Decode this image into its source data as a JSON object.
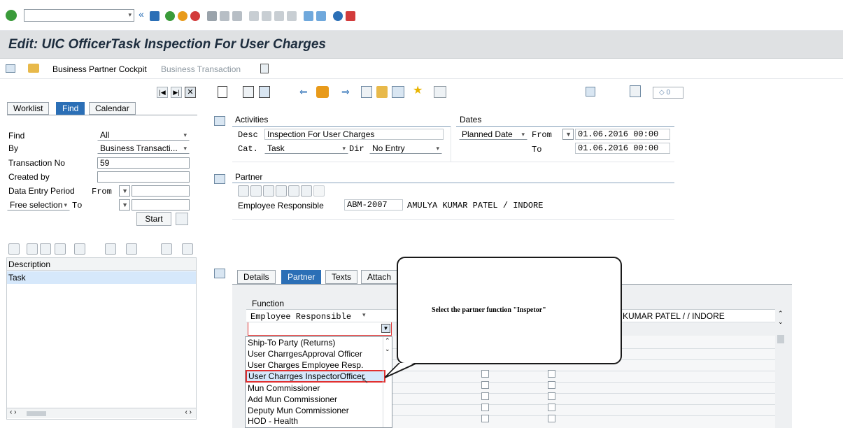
{
  "header": {
    "title": "Edit: UIC OfficerTask Inspection For User Charges",
    "toolbar_links": {
      "business_partner_cockpit": "Business Partner Cockpit",
      "business_transaction": "Business Transaction"
    },
    "counter_value": "◇ 0"
  },
  "left_panel": {
    "tabs": [
      {
        "label": "Worklist",
        "active": false
      },
      {
        "label": "Find",
        "active": true
      },
      {
        "label": "Calendar",
        "active": false
      }
    ],
    "find": {
      "find_label": "Find",
      "find_value": "All",
      "by_label": "By",
      "by_value": "Business Transacti...",
      "transaction_no_label": "Transaction No",
      "transaction_no_value": "59",
      "created_by_label": "Created by",
      "created_by_value": "",
      "data_entry_label": "Data Entry Period",
      "from_label": "From",
      "free_selection_value": "Free selection",
      "to_label": "To",
      "start_label": "Start"
    },
    "results": {
      "column_header": "Description",
      "rows": [
        "Task"
      ]
    }
  },
  "activities": {
    "heading": "Activities",
    "desc_label": "Desc",
    "desc_value": "Inspection For User Charges",
    "cat_label": "Cat.",
    "cat_value": "Task",
    "dir_label": "Dir",
    "dir_value": "No Entry"
  },
  "dates": {
    "heading": "Dates",
    "type_value": "Planned Date",
    "from_label": "From",
    "from_value": "01.06.2016 00:00",
    "to_label": "To",
    "to_value": "01.06.2016 00:00"
  },
  "partner": {
    "heading": "Partner",
    "employee_label": "Employee Responsible",
    "employee_id": "ABM-2007",
    "employee_name": "AMULYA KUMAR PATEL / INDORE"
  },
  "detail_tabs": [
    {
      "label": "Details",
      "active": false
    },
    {
      "label": "Partner",
      "active": true
    },
    {
      "label": "Texts",
      "active": false
    },
    {
      "label": "Attach",
      "active": false
    }
  ],
  "partner_table": {
    "function_header": "Function",
    "row1_function": "Employee Responsible",
    "row1_name": "KUMAR PATEL / / INDORE"
  },
  "dropdown": {
    "options": [
      "Ship-To Party (Returns)",
      "User CharrgesApproval Officer",
      "User Charges Employee Resp.",
      "User Charrges InspectorOfficer",
      "Mun Commissioner",
      "Add Mun Commissioner",
      "Deputy Mun Commissioner",
      "HOD - Health"
    ],
    "selected_index": 3
  },
  "callout": {
    "text": "Select the partner function \"Inspetor\""
  },
  "colors": {
    "accent": "#2b6fb6",
    "highlight_border": "#e03030",
    "title_bar": "#dfe1e3"
  }
}
